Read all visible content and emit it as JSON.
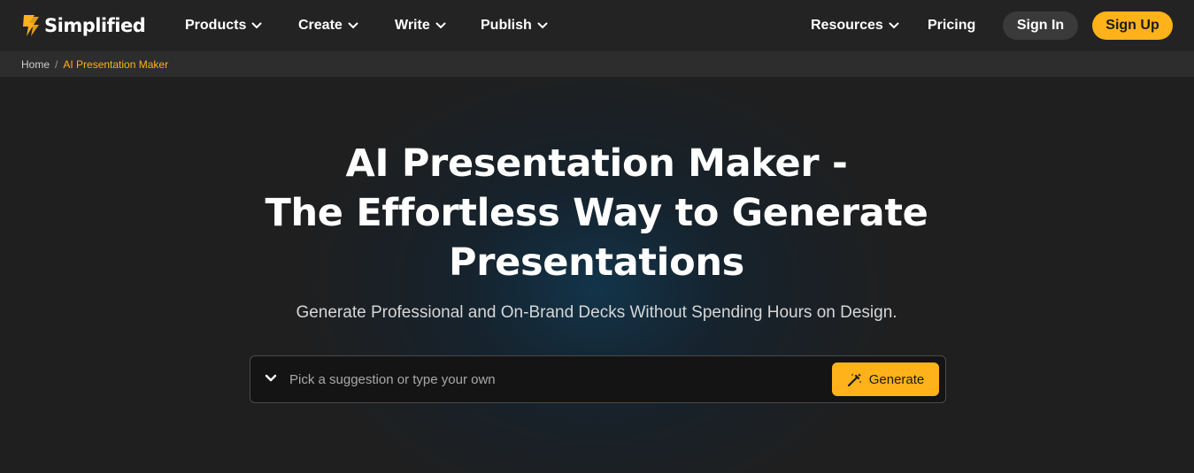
{
  "brand": {
    "name": "Simplified",
    "accent": "#ffb21a"
  },
  "nav": {
    "products": "Products",
    "create": "Create",
    "write": "Write",
    "publish": "Publish",
    "resources": "Resources",
    "pricing": "Pricing",
    "sign_in": "Sign In",
    "sign_up": "Sign Up"
  },
  "breadcrumb": {
    "home": "Home",
    "separator": "/",
    "current": "AI Presentation Maker"
  },
  "hero": {
    "title_line1": "AI Presentation Maker -",
    "title_line2": "The Effortless Way to Generate",
    "title_line3": "Presentations",
    "subtitle": "Generate Professional and On-Brand Decks Without Spending Hours on Design."
  },
  "prompt": {
    "placeholder": "Pick a suggestion or type your own",
    "value": "",
    "generate_label": "Generate"
  },
  "icons": {
    "logo": "simplified-logo-icon",
    "chevron": "chevron-down-icon",
    "generate": "magic-wand-icon"
  }
}
